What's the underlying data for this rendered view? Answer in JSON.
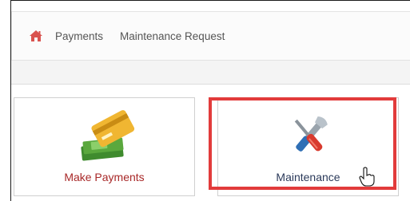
{
  "nav": {
    "home_icon": "home-icon",
    "items": [
      {
        "label": "Payments"
      },
      {
        "label": "Maintenance Request"
      }
    ],
    "home_color": "#d9534f"
  },
  "tiles": [
    {
      "label": "Make Payments",
      "icon": "credit-card-cash-icon",
      "label_color": "#a82828"
    },
    {
      "label": "Maintenance",
      "icon": "wrench-screwdriver-icon",
      "label_color": "#2b3a5a"
    }
  ],
  "highlight": {
    "color": "#e23b3b",
    "target": "Maintenance"
  },
  "cursor_icon": "hand-pointer-icon"
}
